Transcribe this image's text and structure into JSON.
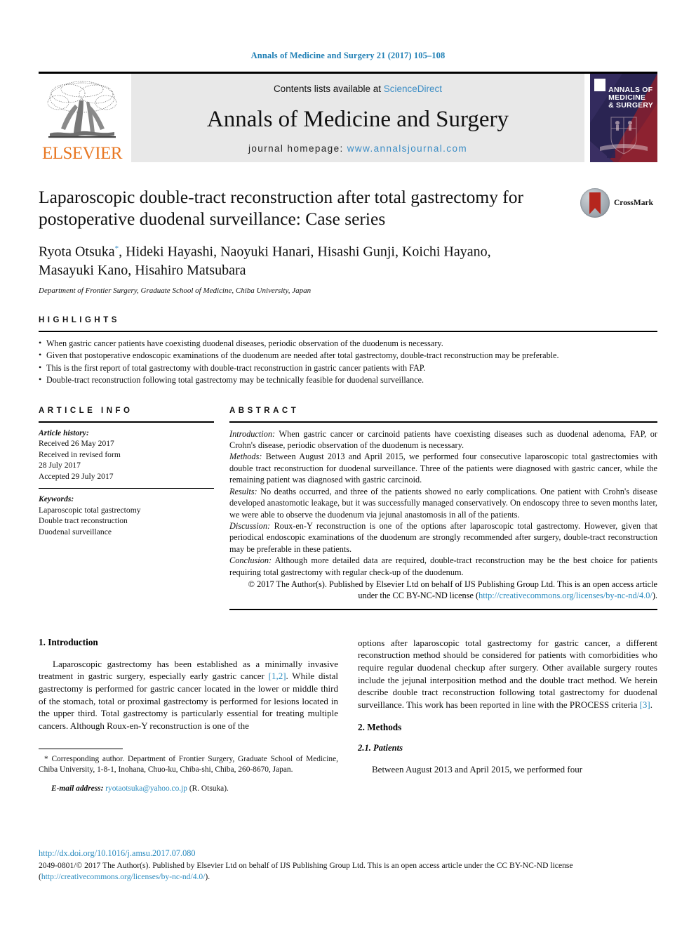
{
  "running_head": "Annals of Medicine and Surgery 21 (2017) 105–108",
  "masthead": {
    "publisher_name": "ELSEVIER",
    "publisher_logo_alt": "elsevier-tree-logo",
    "contents_prefix": "Contents lists available at ",
    "contents_link": "ScienceDirect",
    "journal_name": "Annals of Medicine and Surgery",
    "homepage_prefix": "journal homepage: ",
    "homepage_url": "www.annalsjournal.com",
    "cover": {
      "line1": "ANNALS OF",
      "line2": "MEDICINE",
      "line3": "& SURGERY"
    }
  },
  "article": {
    "title": "Laparoscopic double-tract reconstruction after total gastrectomy for postoperative duodenal surveillance: Case series",
    "authors": "Ryota Otsuka*, Hideki Hayashi, Naoyuki Hanari, Hisashi Gunji, Koichi Hayano, Masayuki Kano, Hisahiro Matsubara",
    "authors_line1_before_star": "Ryota Otsuka",
    "authors_line1_after_star": ", Hideki Hayashi, Naoyuki Hanari, Hisashi Gunji, Koichi Hayano,",
    "authors_line2": "Masayuki Kano, Hisahiro Matsubara",
    "affiliation": "Department of Frontier Surgery, Graduate School of Medicine, Chiba University, Japan",
    "crossmark_label": "CrossMark"
  },
  "highlights": {
    "heading": "HIGHLIGHTS",
    "items": [
      "When gastric cancer patients have coexisting duodenal diseases, periodic observation of the duodenum is necessary.",
      "Given that postoperative endoscopic examinations of the duodenum are needed after total gastrectomy, double-tract reconstruction may be preferable.",
      "This is the first report of total gastrectomy with double-tract reconstruction in gastric cancer patients with FAP.",
      "Double-tract reconstruction following total gastrectomy may be technically feasible for duodenal surveillance."
    ]
  },
  "article_info": {
    "heading": "ARTICLE INFO",
    "history_label": "Article history:",
    "history": [
      "Received 26 May 2017",
      "Received in revised form",
      "28 July 2017",
      "Accepted 29 July 2017"
    ],
    "keywords_label": "Keywords:",
    "keywords": [
      "Laparoscopic total gastrectomy",
      "Double tract reconstruction",
      "Duodenal surveillance"
    ]
  },
  "abstract": {
    "heading": "ABSTRACT",
    "sections": [
      {
        "label": "Introduction:",
        "text": " When gastric cancer or carcinoid patients have coexisting diseases such as duodenal adenoma, FAP, or Crohn's disease, periodic observation of the duodenum is necessary."
      },
      {
        "label": "Methods:",
        "text": " Between August 2013 and April 2015, we performed four consecutive laparoscopic total gastrectomies with double tract reconstruction for duodenal surveillance. Three of the patients were diagnosed with gastric cancer, while the remaining patient was diagnosed with gastric carcinoid."
      },
      {
        "label": "Results:",
        "text": " No deaths occurred, and three of the patients showed no early complications. One patient with Crohn's disease developed anastomotic leakage, but it was successfully managed conservatively. On endoscopy three to seven months later, we were able to observe the duodenum via jejunal anastomosis in all of the patients."
      },
      {
        "label": "Discussion:",
        "text": " Roux-en-Y reconstruction is one of the options after laparoscopic total gastrectomy. However, given that periodical endoscopic examinations of the duodenum are strongly recommended after surgery, double-tract reconstruction may be preferable in these patients."
      },
      {
        "label": "Conclusion:",
        "text": " Although more detailed data are required, double-tract reconstruction may be the best choice for patients requiring total gastrectomy with regular check-up of the duodenum."
      }
    ],
    "copyright_text": "© 2017 The Author(s). Published by Elsevier Ltd on behalf of IJS Publishing Group Ltd. This is an open access article under the CC BY-NC-ND license (",
    "copyright_link": "http://creativecommons.org/licenses/by-nc-nd/4.0/",
    "copyright_tail": ")."
  },
  "body": {
    "left": {
      "section_heading": "1. Introduction",
      "paragraph": "Laparoscopic gastrectomy has been established as a minimally invasive treatment in gastric surgery, especially early gastric cancer [1,2]. While distal gastrectomy is performed for gastric cancer located in the lower or middle third of the stomach, total or proximal gastrectomy is performed for lesions located in the upper third. Total gastrectomy is particularly essential for treating multiple cancers. Although Roux-en-Y reconstruction is one of the",
      "paragraph_pre_ref": "Laparoscopic gastrectomy has been established as a minimally invasive treatment in gastric surgery, especially early gastric cancer ",
      "paragraph_ref": "[1,2]",
      "paragraph_post_ref": ". While distal gastrectomy is performed for gastric cancer located in the lower or middle third of the stomach, total or proximal gastrectomy is performed for lesions located in the upper third. Total gastrectomy is particularly essential for treating multiple cancers. Although Roux-en-Y reconstruction is one of the",
      "footnote_corresponding": "* Corresponding author. Department of Frontier Surgery, Graduate School of Medicine, Chiba University, 1-8-1, Inohana, Chuo-ku, Chiba-shi, Chiba, 260-8670, Japan.",
      "footnote_email_label": "E-mail address:",
      "footnote_email": "ryotaotsuka@yahoo.co.jp",
      "footnote_email_tail": " (R. Otsuka)."
    },
    "right": {
      "paragraph_pre_ref": "options after laparoscopic total gastrectomy for gastric cancer, a different reconstruction method should be considered for patients with comorbidities who require regular duodenal checkup after surgery. Other available surgery routes include the jejunal interposition method and the double tract method. We herein describe double tract reconstruction following total gastrectomy for duodenal surveillance. This work has been reported in line with the PROCESS criteria ",
      "paragraph_ref": "[3]",
      "paragraph_post_ref": ".",
      "section_heading": "2. Methods",
      "subsection_heading": "2.1. Patients",
      "paragraph2": "Between August 2013 and April 2015, we performed four"
    }
  },
  "footer": {
    "doi": "http://dx.doi.org/10.1016/j.amsu.2017.07.080",
    "license_prefix": "2049-0801/© 2017 The Author(s). Published by Elsevier Ltd on behalf of IJS Publishing Group Ltd. This is an open access article under the CC BY-NC-ND license (",
    "license_link": "http://creativecommons.org/licenses/by-nc-nd/4.0/",
    "license_tail": ")."
  },
  "colors": {
    "link": "#2a8bbf",
    "running_head": "#1f7fb5",
    "elsevier_orange": "#E87722",
    "masthead_gray": "#e8e8e8"
  }
}
